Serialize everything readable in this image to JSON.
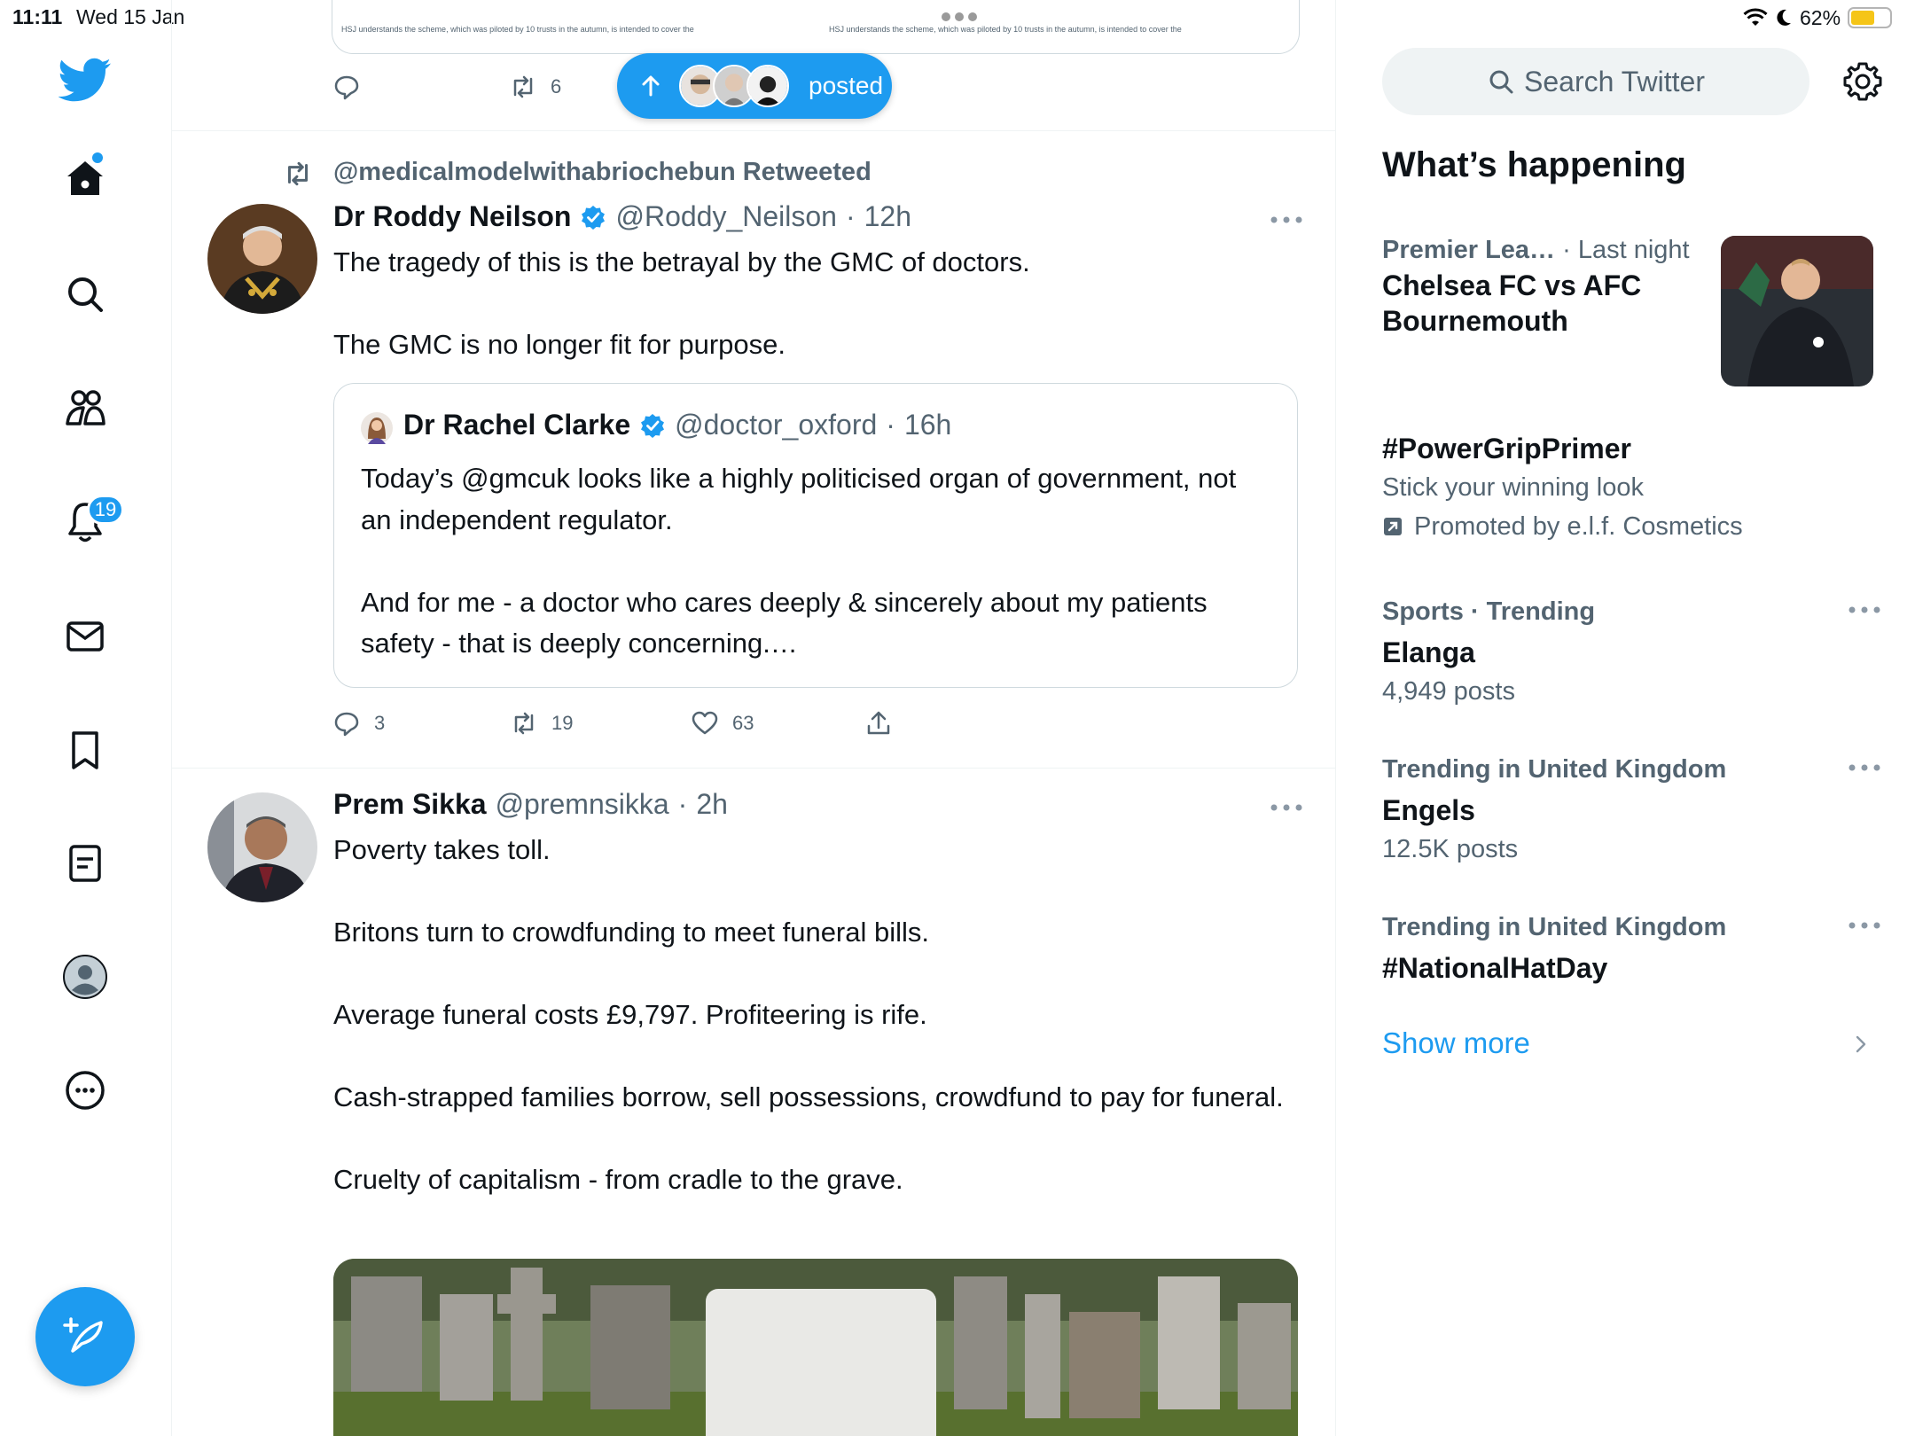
{
  "status_bar": {
    "time": "11:11",
    "date": "Wed 15 Jan",
    "battery": "62%",
    "battery_level": 0.62
  },
  "nav": {
    "notifications_badge": "19"
  },
  "previous_tweet": {
    "caption_left": "HSJ understands the scheme, which was piloted by 10 trusts in the autumn, is intended to cover the",
    "caption_right": "HSJ understands the scheme, which was piloted by 10 trusts in the autumn, is intended to cover the",
    "retweets": "6"
  },
  "new_posts_pill": {
    "label": "posted"
  },
  "tweet1": {
    "retweeted_by": "@medicalmodelwithabriochebun Retweeted",
    "name": "Dr Roddy Neilson",
    "handle": "@Roddy_Neilson",
    "time": "12h",
    "text": "The tragedy of this is the betrayal by the GMC of doctors.\n\nThe GMC is no longer fit for purpose.",
    "quote": {
      "name": "Dr Rachel Clarke",
      "handle": "@doctor_oxford",
      "time": "16h",
      "text": "Today’s @gmcuk looks like a highly politicised organ of government, not an independent regulator.\n\nAnd for me - a doctor who cares deeply & sincerely about my patients safety - that is deeply concerning.…"
    },
    "replies": "3",
    "retweets": "19",
    "likes": "63"
  },
  "tweet2": {
    "name": "Prem Sikka",
    "handle": "@premnsikka",
    "time": "2h",
    "text": "Poverty takes toll.\n\nBritons turn to crowdfunding to meet funeral bills.\n\nAverage funeral costs £9,797. Profiteering is rife.\n\nCash-strapped families borrow, sell possessions, crowdfund to pay for funeral.\n\nCruelty of capitalism - from cradle to the grave."
  },
  "sidebar": {
    "search_placeholder": "Search Twitter",
    "title": "What’s happening",
    "trends": [
      {
        "context": "Premier Lea…",
        "context_extra": "· Last night",
        "name": "Chelsea FC vs AFC Bournemouth"
      },
      {
        "name": "#PowerGripPrimer",
        "sub": "Stick your winning look",
        "promo": "Promoted by e.l.f. Cosmetics"
      },
      {
        "context": "Sports · Trending",
        "name": "Elanga",
        "sub": "4,949 posts"
      },
      {
        "context": "Trending in United Kingdom",
        "name": "Engels",
        "sub": "12.5K posts"
      },
      {
        "context": "Trending in United Kingdom",
        "name": "#NationalHatDay"
      }
    ],
    "show_more": "Show more"
  }
}
